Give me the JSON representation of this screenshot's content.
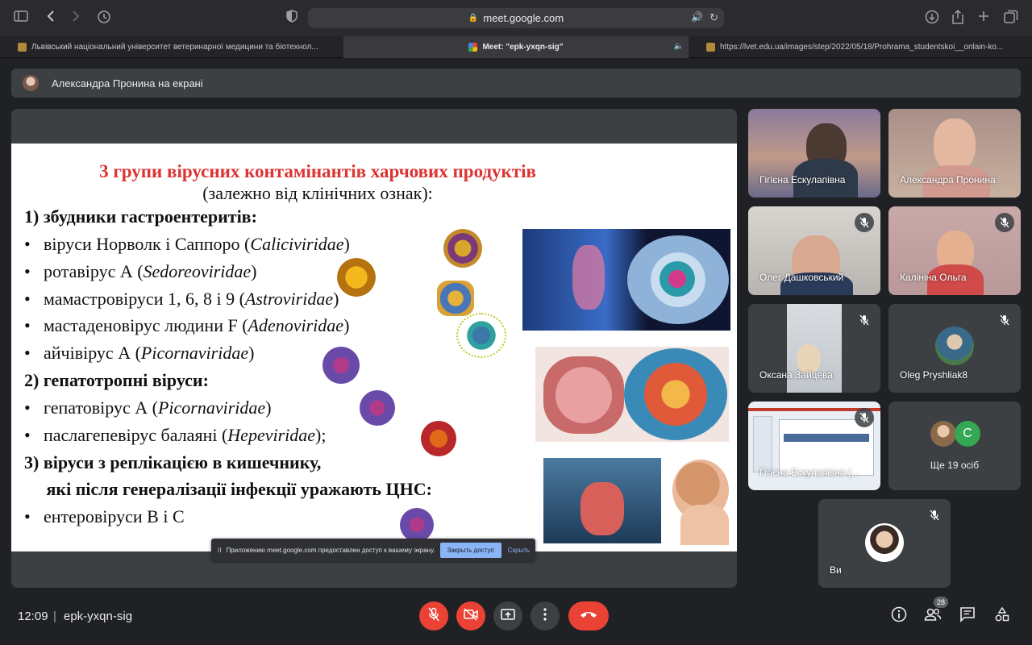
{
  "browser": {
    "url": "meet.google.com",
    "tabs": [
      {
        "title": "Львівський національний університет ветеринарної медицини та біотехнол..."
      },
      {
        "title": "Meet: \"epk-yxqn-sig\""
      },
      {
        "title": "https://lvet.edu.ua/images/step/2022/05/18/Prohrama_studentskoi__onlain-ko..."
      }
    ]
  },
  "meet": {
    "presenter_text": "Александра Пронина на екрані",
    "time": "12:09",
    "separator": "|",
    "meeting_code": "epk-yxqn-sig",
    "people_count": "28"
  },
  "slide": {
    "title": "3 групи вірусних контамінантів харчових продуктів",
    "subtitle": "(залежно від клінічних ознак):",
    "lines": [
      {
        "bullet": "",
        "text": "1) збудники гастроентеритів:"
      },
      {
        "bullet": "•",
        "text": "віруси Норволк і Саппоро (",
        "italic": "Caliciviridae",
        "tail": ")"
      },
      {
        "bullet": "•",
        "text": "ротавірус А (",
        "italic": "Sedoreoviridae",
        "tail": ")"
      },
      {
        "bullet": "•",
        "text": "мамастровіруси 1, 6, 8 і 9 (",
        "italic": "Astroviridae",
        "tail": ")"
      },
      {
        "bullet": "•",
        "text": "мастаденовірус людини F (",
        "italic": "Adenoviridae",
        "tail": ")"
      },
      {
        "bullet": "•",
        "text": "айчівірус А (",
        "italic": "Picornaviridae",
        "tail": ")"
      },
      {
        "bullet": "",
        "text": "2) гепатотропні віруси:"
      },
      {
        "bullet": "•",
        "text": "гепатовірус А (",
        "italic": "Picornaviridae",
        "tail": ")"
      },
      {
        "bullet": "•",
        "text": "паслагепевірус балаяні (",
        "italic": "Hepeviridae",
        "tail": ");"
      },
      {
        "bullet": "",
        "text": "3) віруси з реплікацією в кишечнику,"
      },
      {
        "bullet": "",
        "text": "     які після генералізації інфекції уражають ЦНС:"
      },
      {
        "bullet": "•",
        "text": "ентеровіруси В і С",
        "italic": "",
        "tail": ""
      }
    ],
    "share_popup": {
      "pause": "II",
      "message": "Приложению meet.google.com предоставлен доступ к вашему экрану.",
      "stop": "Закрыть доступ",
      "hide": "Скрыть"
    }
  },
  "participants": [
    {
      "name": "Гігієна Ескулапівна",
      "muted": false
    },
    {
      "name": "Александра Пронина",
      "muted": false
    },
    {
      "name": "Олег Дашковський",
      "muted": true
    },
    {
      "name": "Калініна Ольга",
      "muted": true
    },
    {
      "name": "Оксана Зайцева",
      "muted": true
    },
    {
      "name": "Oleg Pryshliak8",
      "muted": true
    },
    {
      "name": "Гігієна Ескулапівна (...",
      "muted": true
    },
    {
      "name": "Ще 19 осіб",
      "muted": false
    },
    {
      "name": "Ви",
      "muted": true
    }
  ],
  "more_avatar_letter": "C",
  "colors": {
    "accent_red": "#ea4335",
    "surface": "#3c4043",
    "background": "#202124",
    "slide_title": "#dd3333",
    "link_blue": "#8ab4f8",
    "avatar_green": "#34a853"
  }
}
